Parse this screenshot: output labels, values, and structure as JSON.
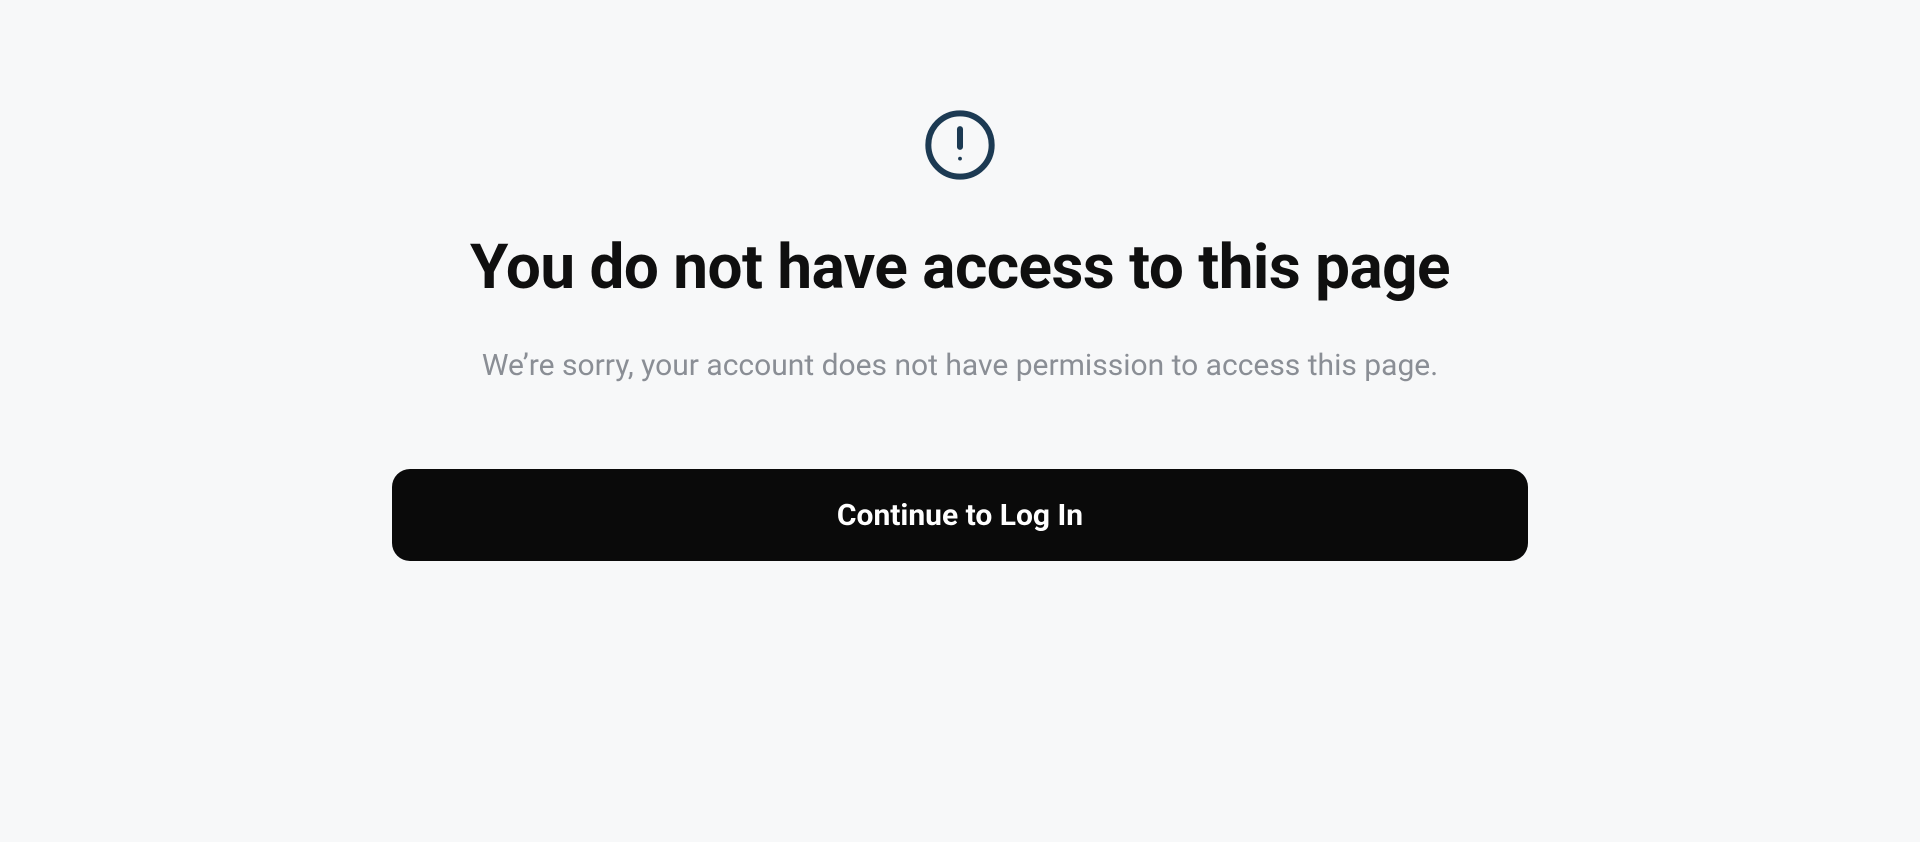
{
  "error": {
    "heading": "You do not have access to this page",
    "subtext": "We’re sorry, your account does not have permission to access this page.",
    "button_label": "Continue to Log In"
  }
}
